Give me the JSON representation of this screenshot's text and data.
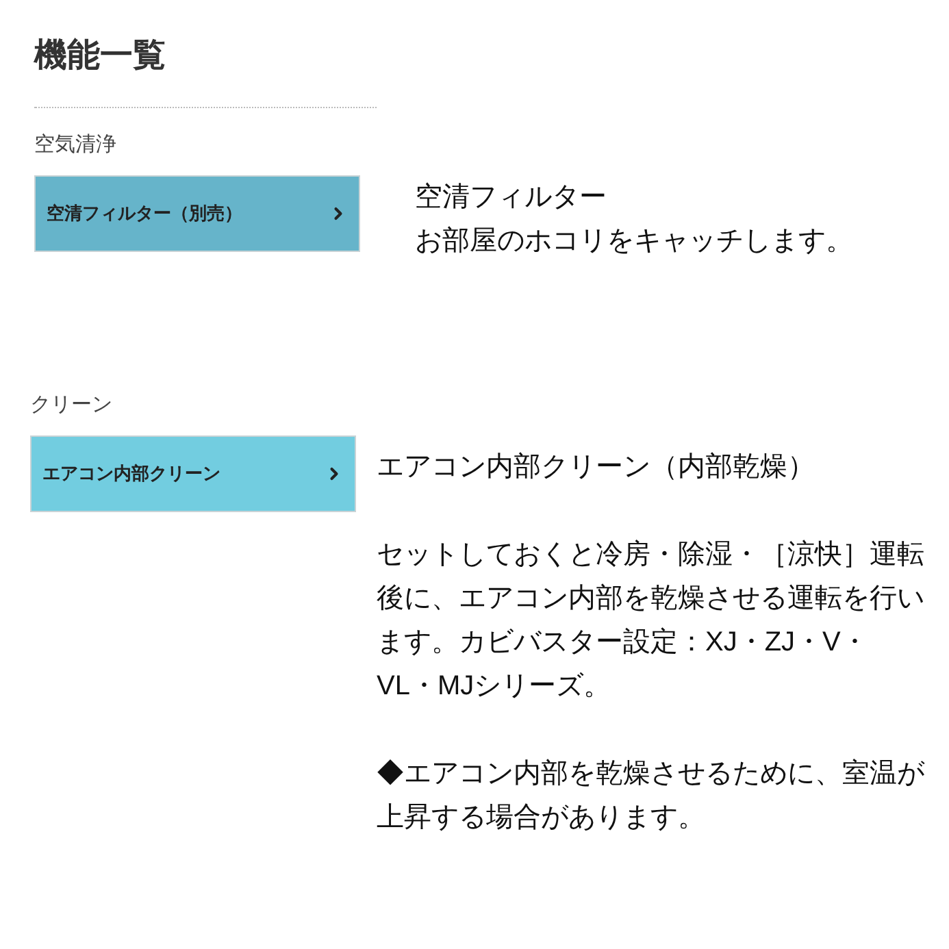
{
  "title": "機能一覧",
  "sections": [
    {
      "label": "空気清浄",
      "button": {
        "label": "空清フィルター（別売）",
        "color": "#66b4ca"
      },
      "description": {
        "title": "空清フィルター",
        "paragraphs": [
          "お部屋のホコリをキャッチします。"
        ]
      }
    },
    {
      "label": "クリーン",
      "button": {
        "label": "エアコン内部クリーン",
        "color": "#72cde0"
      },
      "description": {
        "title": "エアコン内部クリーン（内部乾燥）",
        "paragraphs": [
          "セットしておくと冷房・除湿・［涼快］運転後に、エアコン内部を乾燥させる運転を行います。カビバスター設定：XJ・ZJ・V・VL・MJシリーズ。",
          "◆エアコン内部を乾燥させるために、室温が上昇する場合があります。"
        ]
      }
    }
  ]
}
